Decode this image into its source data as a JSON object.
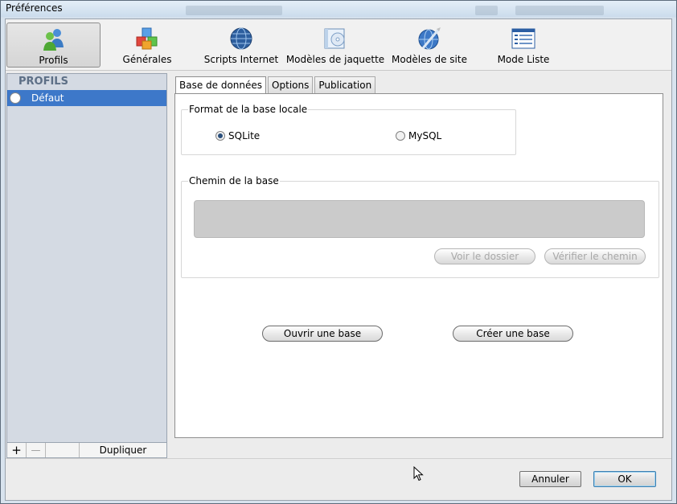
{
  "window": {
    "title": "Préférences"
  },
  "toolbar": {
    "items": [
      {
        "label": "Profils",
        "icon": "users-icon",
        "active": true
      },
      {
        "label": "Générales",
        "icon": "cubes-icon"
      },
      {
        "label": "Scripts Internet",
        "icon": "globe-icon"
      },
      {
        "label": "Modèles de jaquette",
        "icon": "disc-case-icon"
      },
      {
        "label": "Modèles de site",
        "icon": "web-globe-icon"
      },
      {
        "label": "Mode Liste",
        "icon": "list-icon"
      }
    ]
  },
  "sidebar": {
    "header": "PROFILS",
    "items": [
      {
        "label": "Défaut",
        "selected": true
      }
    ],
    "add_label": "+",
    "remove_label": "—",
    "duplicate_label": "Dupliquer"
  },
  "tabs": [
    {
      "label": "Base de données",
      "active": true
    },
    {
      "label": "Options"
    },
    {
      "label": "Publication"
    }
  ],
  "format_group": {
    "legend": "Format de la base locale",
    "options": [
      {
        "label": "SQLite",
        "selected": true
      },
      {
        "label": "MySQL",
        "selected": false
      }
    ]
  },
  "path_group": {
    "legend": "Chemin de la base",
    "path_value": "",
    "view_folder_label": "Voir le dossier",
    "verify_path_label": "Vérifier le chemin"
  },
  "actions": {
    "open_label": "Ouvrir une base",
    "create_label": "Créer une base"
  },
  "footer": {
    "cancel_label": "Annuler",
    "ok_label": "OK"
  },
  "colors": {
    "selection": "#3d78c9",
    "sidebar_bg": "#d4dae3",
    "sidebar_header": "#5d6f86"
  }
}
